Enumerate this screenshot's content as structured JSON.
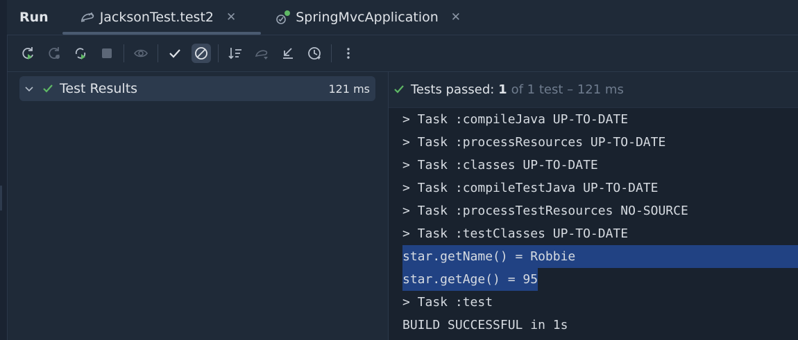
{
  "tabbar": {
    "run_label": "Run",
    "tabs": [
      {
        "label": "JacksonTest.test2",
        "icon": "test-runner-icon",
        "active": true
      },
      {
        "label": "SpringMvcApplication",
        "icon": "spring-boot-icon",
        "active": false
      }
    ]
  },
  "toolbar": {
    "buttons": [
      "rerun-icon",
      "rerun-failed-icon",
      "toggle-autotest-icon",
      "stop-icon",
      "show-ignored-icon",
      "show-passed-icon",
      "show-ignored-toggle-icon",
      "sort-icon",
      "import-tests-icon",
      "collapse-icon",
      "history-icon",
      "more-icon"
    ]
  },
  "test_tree": {
    "root_label": "Test Results",
    "root_time": "121 ms"
  },
  "status": {
    "passed_label": "Tests passed:",
    "passed_count": "1",
    "rest": "of 1 test – 121 ms"
  },
  "console": {
    "lines": [
      "> Task :compileJava UP-TO-DATE",
      "> Task :processResources UP-TO-DATE",
      "> Task :classes UP-TO-DATE",
      "> Task :compileTestJava UP-TO-DATE",
      "> Task :processTestResources NO-SOURCE",
      "> Task :testClasses UP-TO-DATE",
      "star.getName() = Robbie",
      "star.getAge() = 95",
      "> Task :test",
      "BUILD SUCCESSFUL in 1s"
    ]
  },
  "colors": {
    "background": "#1f2a38",
    "console_bg": "#19222e",
    "selection": "#214283",
    "success_green": "#5fb865",
    "muted_text": "#6f7c8e"
  }
}
